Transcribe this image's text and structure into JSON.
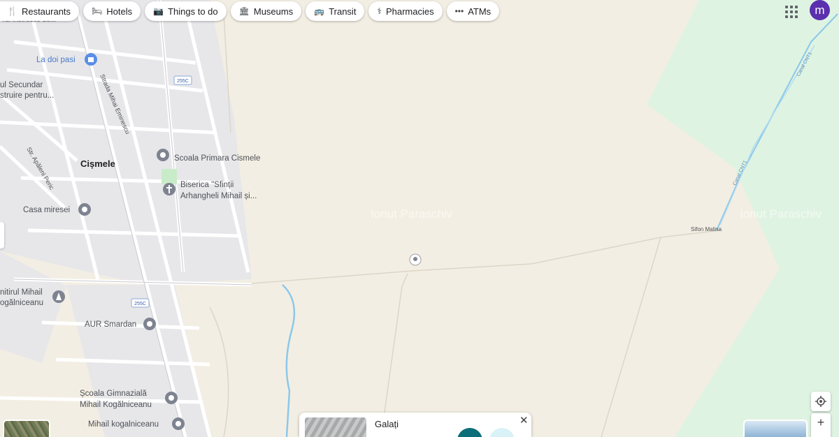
{
  "chips": [
    {
      "label": "Restaurants",
      "icon": "fork-knife-icon",
      "glyph": "🍴"
    },
    {
      "label": "Hotels",
      "icon": "bed-icon",
      "glyph": "🛏"
    },
    {
      "label": "Things to do",
      "icon": "camera-icon",
      "glyph": "📷"
    },
    {
      "label": "Museums",
      "icon": "museum-icon",
      "glyph": "🏛"
    },
    {
      "label": "Transit",
      "icon": "bus-icon",
      "glyph": "🚌"
    },
    {
      "label": "Pharmacies",
      "icon": "pharmacy-icon",
      "glyph": "⚕"
    },
    {
      "label": "ATMs",
      "icon": "atm-icon",
      "glyph": "•••"
    }
  ],
  "account": {
    "initial": "m",
    "color": "#5b2fae"
  },
  "map": {
    "place_labels": {
      "cut_top": "rul instructie de...",
      "la_doi_pasi": "La doi pasi",
      "secundar_1": "ul Secundar",
      "secundar_2": "struire pentru...",
      "street_eminescu": "Strada Mihai Eminescu",
      "street_apaleni": "Str. Apăleni Peric",
      "cismele": "Cișmele",
      "scoala_primara": "Scoala Primara Cismele",
      "biserica_1": "Biserica \"Sfinții",
      "biserica_2": "Arhangheli Mihail și...",
      "casa_miresei": "Casa miresei",
      "monument_1": "nitirul Mihail",
      "monument_2": "ogălniceanu",
      "aur": "AUR Smardan",
      "scoala_gim_1": "Școala Gimnazială",
      "scoala_gim_2": "Mihail Kogălniceanu",
      "mihail_k": "Mihail kogalniceanu",
      "sifon": "Sifon Malina",
      "canal_1": "Canal CNT1",
      "canal_2": "Canal CNT1"
    },
    "route_shields": [
      "255C",
      "255C"
    ],
    "watermark": "Ionut Paraschiv",
    "colors": {
      "land": "#f3eee3",
      "green": "#dff3e2",
      "settlement": "#e7e7ea",
      "road": "#ffffff",
      "water": "#8cc8ea"
    }
  },
  "place_card": {
    "title": "Galați"
  }
}
